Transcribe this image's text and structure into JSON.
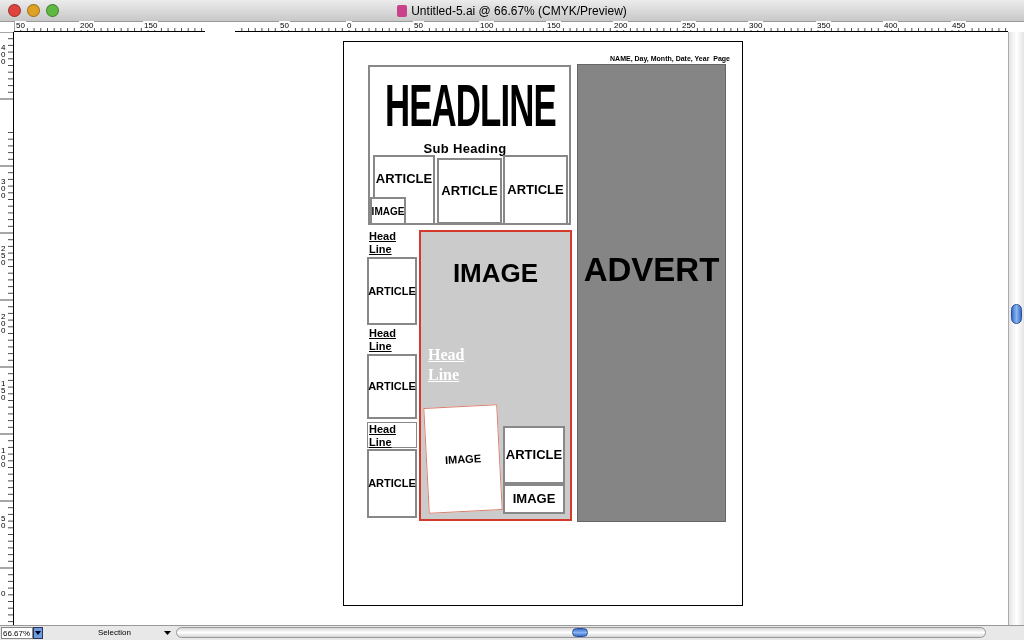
{
  "window": {
    "title": "Untitled-5.ai @ 66.67% (CMYK/Preview)"
  },
  "top_ruler": [
    "50",
    "200",
    "150",
    "50",
    "0",
    "50",
    "100",
    "150",
    "200",
    "250",
    "300",
    "350",
    "400",
    "450"
  ],
  "left_ruler": [
    "400",
    "300",
    "250",
    "200",
    "150",
    "100",
    "50",
    "0"
  ],
  "artboard": {
    "header_line": "NAME, Day, Month, Date, Year  Page",
    "items": [
      {
        "kind": "panel"
      },
      {
        "kind": "headline",
        "text": "HEADLINE"
      },
      {
        "kind": "subheading",
        "text": "Sub Heading"
      },
      {
        "kind": "frame",
        "text": "ARTICLE"
      },
      {
        "kind": "frame",
        "text": "ARTICLE"
      },
      {
        "kind": "frame",
        "text": "ARTICLE"
      },
      {
        "kind": "frame",
        "text": "IMAGE"
      },
      {
        "kind": "headline_small",
        "text": "Head Line"
      },
      {
        "kind": "frame",
        "text": "ARTICLE"
      },
      {
        "kind": "headline_small",
        "text": "Head Line"
      },
      {
        "kind": "frame",
        "text": "ARTICLE"
      },
      {
        "kind": "headline_boxed",
        "text": "Head Line"
      },
      {
        "kind": "frame",
        "text": "ARTICLE"
      },
      {
        "kind": "feature",
        "text": "IMAGE"
      },
      {
        "kind": "headline_white",
        "text": "Head Line"
      },
      {
        "kind": "tilted",
        "text": "IMAGE"
      },
      {
        "kind": "frame",
        "text": "ARTICLE"
      },
      {
        "kind": "frame",
        "text": "IMAGE"
      },
      {
        "kind": "advert",
        "text": "ADVERT"
      }
    ]
  },
  "status_bar": {
    "zoom": "66.67%",
    "tool": "Selection"
  }
}
